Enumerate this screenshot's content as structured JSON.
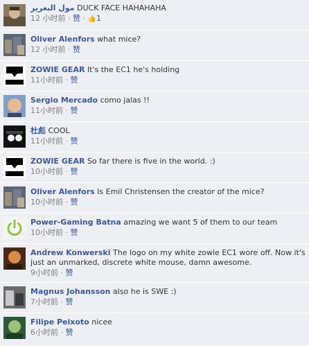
{
  "comments": [
    {
      "author": "مول البغرير",
      "text": "DUCK FACE HAHAHAHA",
      "time": "12 小时前",
      "sep": " · ",
      "like_label": "赞",
      "likes_count": "1",
      "avatar_icon": "user-photo-icon",
      "avatar_colors": [
        "#7b6a52",
        "#c9b28d"
      ]
    },
    {
      "author": "Oliver Alenfors",
      "text": "what mice?",
      "time": "12 小时前",
      "sep": " · ",
      "like_label": "赞",
      "avatar_icon": "user-photo-icon",
      "avatar_colors": [
        "#4a5a7a",
        "#a9a28a"
      ]
    },
    {
      "author": "ZOWIE GEAR",
      "text": "It's the EC1 he's holding",
      "time": "11小时前",
      "sep": " · ",
      "like_label": "赞",
      "avatar_icon": "zowie-logo-icon",
      "avatar_colors": [
        "#ffffff",
        "#000000"
      ]
    },
    {
      "author": "Sergio Mercado",
      "text": "como jalas !!",
      "time": "11小时前",
      "sep": " · ",
      "like_label": "赞",
      "avatar_icon": "user-photo-icon",
      "avatar_colors": [
        "#d9b08c",
        "#6a8fb8"
      ]
    },
    {
      "author": "杜彪",
      "text": "COOL",
      "time": "11小时前",
      "sep": " · ",
      "like_label": "赞",
      "avatar_icon": "user-photo-icon",
      "avatar_colors": [
        "#111111",
        "#eeeeee"
      ]
    },
    {
      "author": "ZOWIE GEAR",
      "text": "So far there is five in the world. :)",
      "time": "10小时前",
      "sep": " · ",
      "like_label": "赞",
      "avatar_icon": "zowie-logo-icon",
      "avatar_colors": [
        "#ffffff",
        "#000000"
      ]
    },
    {
      "author": "Oliver Alenfors",
      "text": "Is Emil Christensen the creator of the mice?",
      "time": "10小时前",
      "sep": " · ",
      "like_label": "赞",
      "avatar_icon": "user-photo-icon",
      "avatar_colors": [
        "#4a5a7a",
        "#a9a28a"
      ]
    },
    {
      "author": "Power-Gaming Batna",
      "text": "amazing we want 5 of them to our team",
      "time": "10小时前",
      "sep": " · ",
      "like_label": "赞",
      "avatar_icon": "power-button-icon",
      "avatar_colors": [
        "#f4f4f4",
        "#8cc63f"
      ]
    },
    {
      "author": "Andrew Konwerski",
      "text": "The logo on my white zowie EC1 wore off. Now it's just an unmarked, discrete white mouse, damn awesome.",
      "time": "9小时前",
      "sep": " · ",
      "like_label": "赞",
      "avatar_icon": "user-photo-icon",
      "avatar_colors": [
        "#6b3a1e",
        "#d98b4a"
      ]
    },
    {
      "author": "Magnus Johansson",
      "text": "also he is SWE :)",
      "time": "7小时前",
      "sep": " · ",
      "like_label": "赞",
      "avatar_icon": "user-photo-icon",
      "avatar_colors": [
        "#5a5a5a",
        "#c8c8c8"
      ]
    },
    {
      "author": "Filipe Peixoto",
      "text": "nicee",
      "time": "6小时前",
      "sep": " · ",
      "like_label": "赞",
      "avatar_icon": "user-photo-icon",
      "avatar_colors": [
        "#2e5a3a",
        "#9cc27a"
      ]
    }
  ]
}
